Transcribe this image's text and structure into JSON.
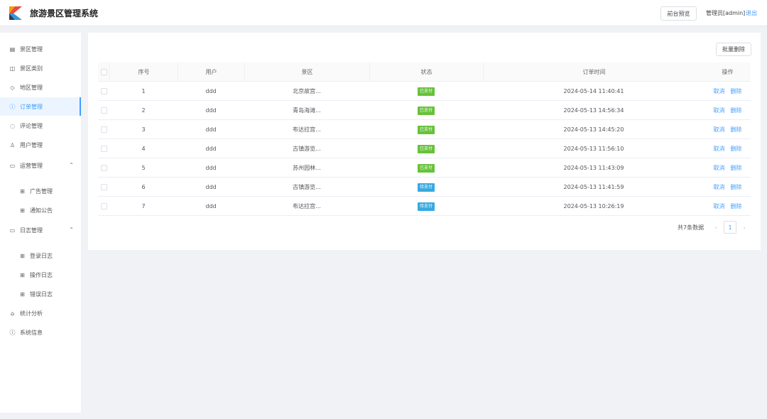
{
  "header": {
    "title": "旅游景区管理系统",
    "preview_label": "前台预览",
    "admin_label": "管理员[admin]",
    "logout_label": "退出"
  },
  "sidebar": {
    "items": [
      {
        "label": "景区管理",
        "icon": "document-icon"
      },
      {
        "label": "景区类别",
        "icon": "book-icon"
      },
      {
        "label": "地区管理",
        "icon": "tag-icon"
      },
      {
        "label": "订单管理",
        "icon": "info-icon",
        "active": true
      },
      {
        "label": "评论管理",
        "icon": "comment-icon"
      },
      {
        "label": "用户管理",
        "icon": "user-icon"
      },
      {
        "label": "运营管理",
        "icon": "folder-icon"
      },
      {
        "label": "广告管理",
        "icon": "grid-icon"
      },
      {
        "label": "通知公告",
        "icon": "grid-icon"
      },
      {
        "label": "日志管理",
        "icon": "folder-icon"
      },
      {
        "label": "登录日志",
        "icon": "grid-icon"
      },
      {
        "label": "操作日志",
        "icon": "grid-icon"
      },
      {
        "label": "错误日志",
        "icon": "grid-icon"
      },
      {
        "label": "统计分析",
        "icon": "home-icon"
      },
      {
        "label": "系统信息",
        "icon": "info-icon"
      }
    ]
  },
  "toolbar": {
    "batch_delete_label": "批量删除"
  },
  "table": {
    "headers": {
      "seq": "序号",
      "user": "用户",
      "spot": "景区",
      "status": "状态",
      "time": "订单时间",
      "ops": "操作"
    },
    "rows": [
      {
        "seq": "1",
        "user": "ddd",
        "spot": "北京故宫...",
        "status": "已支付",
        "status_color": "#67c23a",
        "time": "2024-05-14 11:40:41",
        "op1": "取消",
        "op2": "删除"
      },
      {
        "seq": "2",
        "user": "ddd",
        "spot": "青岛海滩...",
        "status": "已支付",
        "status_color": "#67c23a",
        "time": "2024-05-13 14:56:34",
        "op1": "取消",
        "op2": "删除"
      },
      {
        "seq": "3",
        "user": "ddd",
        "spot": "布达拉宫...",
        "status": "已支付",
        "status_color": "#67c23a",
        "time": "2024-05-13 14:45:20",
        "op1": "取消",
        "op2": "删除"
      },
      {
        "seq": "4",
        "user": "ddd",
        "spot": "古镇游览...",
        "status": "已支付",
        "status_color": "#67c23a",
        "time": "2024-05-13 11:56:10",
        "op1": "取消",
        "op2": "删除"
      },
      {
        "seq": "5",
        "user": "ddd",
        "spot": "苏州园林...",
        "status": "已支付",
        "status_color": "#67c23a",
        "time": "2024-05-13 11:43:09",
        "op1": "取消",
        "op2": "删除"
      },
      {
        "seq": "6",
        "user": "ddd",
        "spot": "古镇游览...",
        "status": "待支付",
        "status_color": "#36a9e1",
        "time": "2024-05-13 11:41:59",
        "op1": "取消",
        "op2": "删除"
      },
      {
        "seq": "7",
        "user": "ddd",
        "spot": "布达拉宫...",
        "status": "待支付",
        "status_color": "#36a9e1",
        "time": "2024-05-13 10:26:19",
        "op1": "取消",
        "op2": "删除"
      }
    ]
  },
  "pagination": {
    "total_label": "共7条数据",
    "current_page": "1",
    "prev": "‹",
    "next": "›"
  },
  "colors": {
    "accent": "#409eff",
    "paid": "#67c23a",
    "pending": "#36a9e1"
  }
}
